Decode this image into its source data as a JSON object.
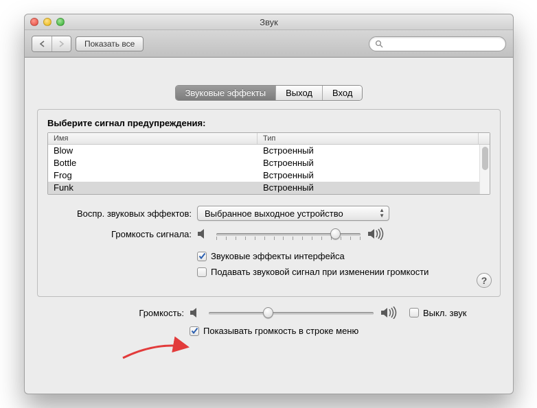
{
  "window": {
    "title": "Звук"
  },
  "toolbar": {
    "show_all": "Показать все",
    "search_placeholder": ""
  },
  "tabs": {
    "effects": "Звуковые эффекты",
    "output": "Выход",
    "input": "Вход",
    "active": "effects"
  },
  "alert": {
    "heading": "Выберите сигнал предупреждения:",
    "columns": {
      "name": "Имя",
      "type": "Тип"
    },
    "sounds": [
      {
        "name": "Blow",
        "type": "Встроенный",
        "selected": false
      },
      {
        "name": "Bottle",
        "type": "Встроенный",
        "selected": false
      },
      {
        "name": "Frog",
        "type": "Встроенный",
        "selected": false
      },
      {
        "name": "Funk",
        "type": "Встроенный",
        "selected": true
      }
    ],
    "play_through_label": "Воспр. звуковых эффектов:",
    "play_through_value": "Выбранное выходное устройство",
    "alert_volume_label": "Громкость сигнала:",
    "alert_volume_pct": 85,
    "chk_ui_sounds": {
      "label": "Звуковые эффекты интерфейса",
      "checked": true
    },
    "chk_feedback": {
      "label": "Подавать звуковой сигнал при изменении громкости",
      "checked": false
    }
  },
  "output": {
    "volume_label": "Громкость:",
    "volume_pct": 35,
    "mute": {
      "label": "Выкл. звук",
      "checked": false
    },
    "show_menu": {
      "label": "Показывать громкость в строке меню",
      "checked": true
    }
  },
  "icons": {
    "back": "back-icon",
    "forward": "forward-icon",
    "search": "search-icon",
    "speaker_low": "speaker-low-icon",
    "speaker_high": "speaker-high-icon",
    "help": "?"
  }
}
